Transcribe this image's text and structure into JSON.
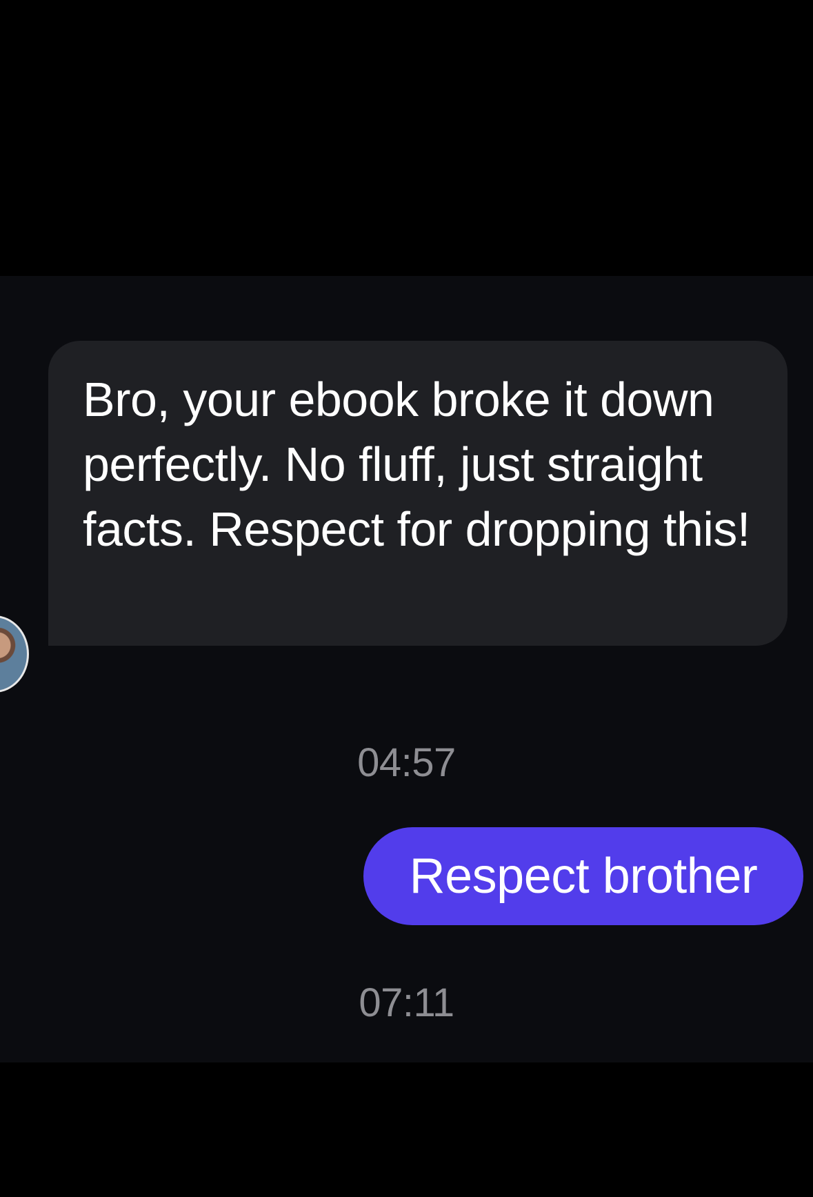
{
  "conversation": {
    "messages": [
      {
        "direction": "incoming",
        "text": "Bro, your ebook broke it down perfectly. No fluff, just straight facts. Respect for dropping this!",
        "timestamp": "04:57"
      },
      {
        "direction": "outgoing",
        "text": "Respect brother",
        "timestamp": "07:11"
      }
    ],
    "avatar_icon": "user-avatar-icon"
  },
  "colors": {
    "background": "#000000",
    "chat_background": "#0b0c10",
    "incoming_bubble": "#1f2024",
    "outgoing_bubble": "#523deb",
    "timestamp": "#8e8e93",
    "text": "#ffffff"
  }
}
